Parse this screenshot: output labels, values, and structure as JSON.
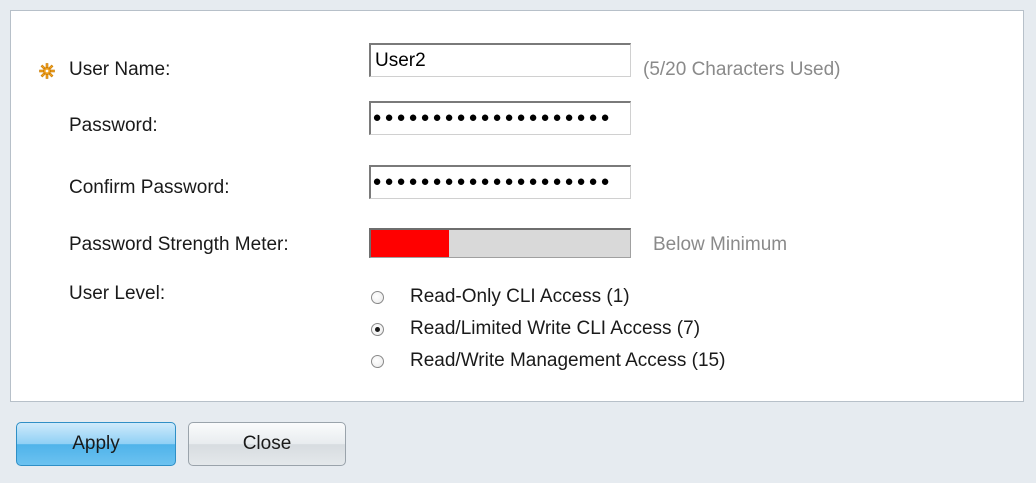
{
  "form": {
    "user_name": {
      "label": "User Name:",
      "value": "User2",
      "hint": "(5/20 Characters Used)"
    },
    "password": {
      "label": "Password:",
      "masked_count": 20
    },
    "confirm_password": {
      "label": "Confirm Password:",
      "masked_count": 20
    },
    "strength": {
      "label": "Password Strength Meter:",
      "level_percent": 30,
      "status": "Below Minimum",
      "fill_color": "#ff0000"
    },
    "user_level": {
      "label": "User Level:",
      "options": [
        {
          "label": "Read-Only CLI Access (1)",
          "selected": false
        },
        {
          "label": "Read/Limited Write CLI Access (7)",
          "selected": true
        },
        {
          "label": "Read/Write Management Access (15)",
          "selected": false
        }
      ]
    }
  },
  "actions": {
    "apply_label": "Apply",
    "close_label": "Close"
  },
  "icons": {
    "required": "required-asterisk-icon"
  },
  "colors": {
    "apply_accent": "#4fb3ea",
    "required_icon": "#f0a020"
  }
}
